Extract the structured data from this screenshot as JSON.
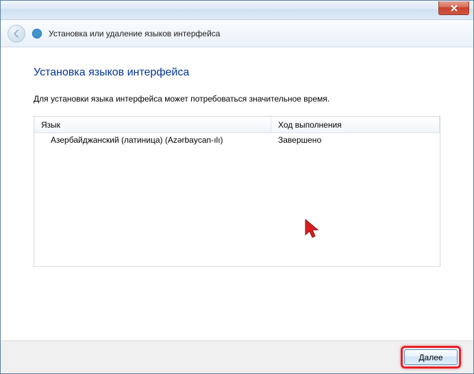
{
  "window": {
    "title": "Установка или удаление языков интерфейса"
  },
  "page": {
    "title": "Установка языков интерфейса",
    "description": "Для установки языка интерфейса может потребоваться значительное время."
  },
  "table": {
    "columns": {
      "language": "Язык",
      "progress": "Ход выполнения"
    },
    "rows": [
      {
        "language": "Азербайджанский (латиница) (Azərbaycan-ılı)",
        "progress": "Завершено"
      }
    ]
  },
  "buttons": {
    "next": "Далее"
  }
}
